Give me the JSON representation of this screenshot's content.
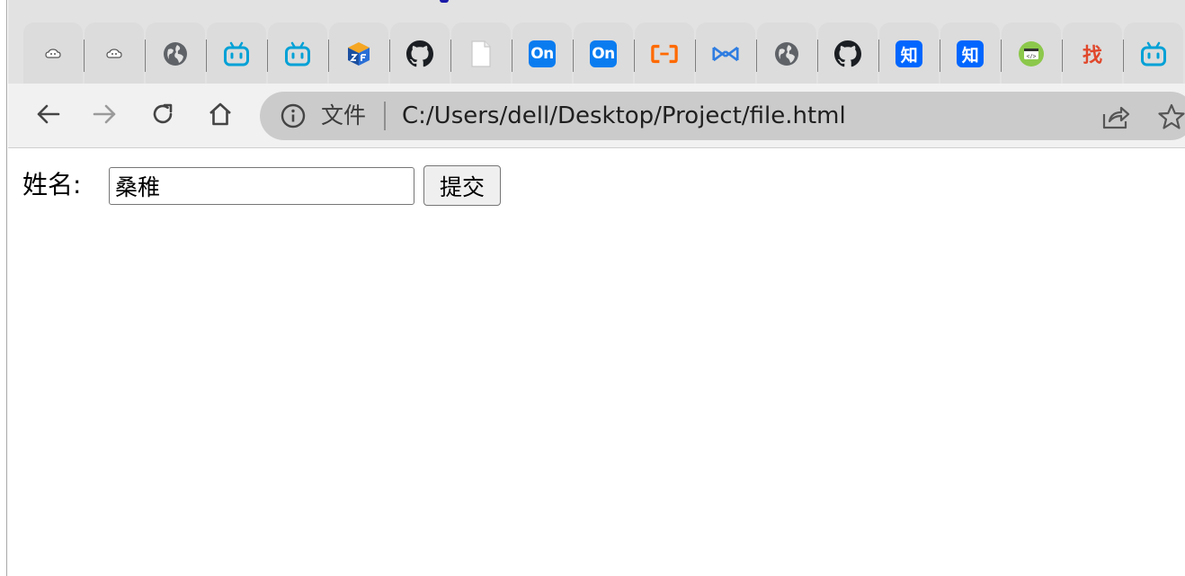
{
  "browser": {
    "tabs": [
      {
        "icon": "cloud-favicon-icon"
      },
      {
        "icon": "cloud-favicon-icon"
      },
      {
        "icon": "globe-icon"
      },
      {
        "icon": "bilibili-icon"
      },
      {
        "icon": "bilibili-icon"
      },
      {
        "icon": "cube-logo-icon"
      },
      {
        "icon": "github-icon"
      },
      {
        "icon": "blank-page-icon"
      },
      {
        "icon": "on-badge-icon",
        "text": "On"
      },
      {
        "icon": "on-badge-icon",
        "text": "On"
      },
      {
        "icon": "aliyun-icon"
      },
      {
        "icon": "bowtie-logo-icon"
      },
      {
        "icon": "globe-icon"
      },
      {
        "icon": "github-icon"
      },
      {
        "icon": "zhihu-icon",
        "text": "知"
      },
      {
        "icon": "zhihu-icon",
        "text": "知"
      },
      {
        "icon": "code-window-icon"
      },
      {
        "icon": "zhao-icon",
        "text": "找"
      },
      {
        "icon": "bilibili-icon"
      }
    ],
    "toolbar": {
      "back_icon": "back-arrow-icon",
      "forward_icon": "forward-arrow-icon",
      "reload_icon": "reload-icon",
      "home_icon": "home-icon"
    },
    "omnibox": {
      "info_icon": "info-icon",
      "chip_label": "文件",
      "url": "C:/Users/dell/Desktop/Project/file.html",
      "share_icon": "share-icon",
      "bookmark_icon": "star-icon"
    }
  },
  "page": {
    "label": "姓名:",
    "input_value": "桑稚",
    "submit_label": "提交"
  },
  "colors": {
    "bilibili": "#00a1d6",
    "on_badge": "#0a7cf0",
    "zhihu": "#0066ff",
    "aliyun": "#ff6a00",
    "code_window": "#8cc84b"
  }
}
